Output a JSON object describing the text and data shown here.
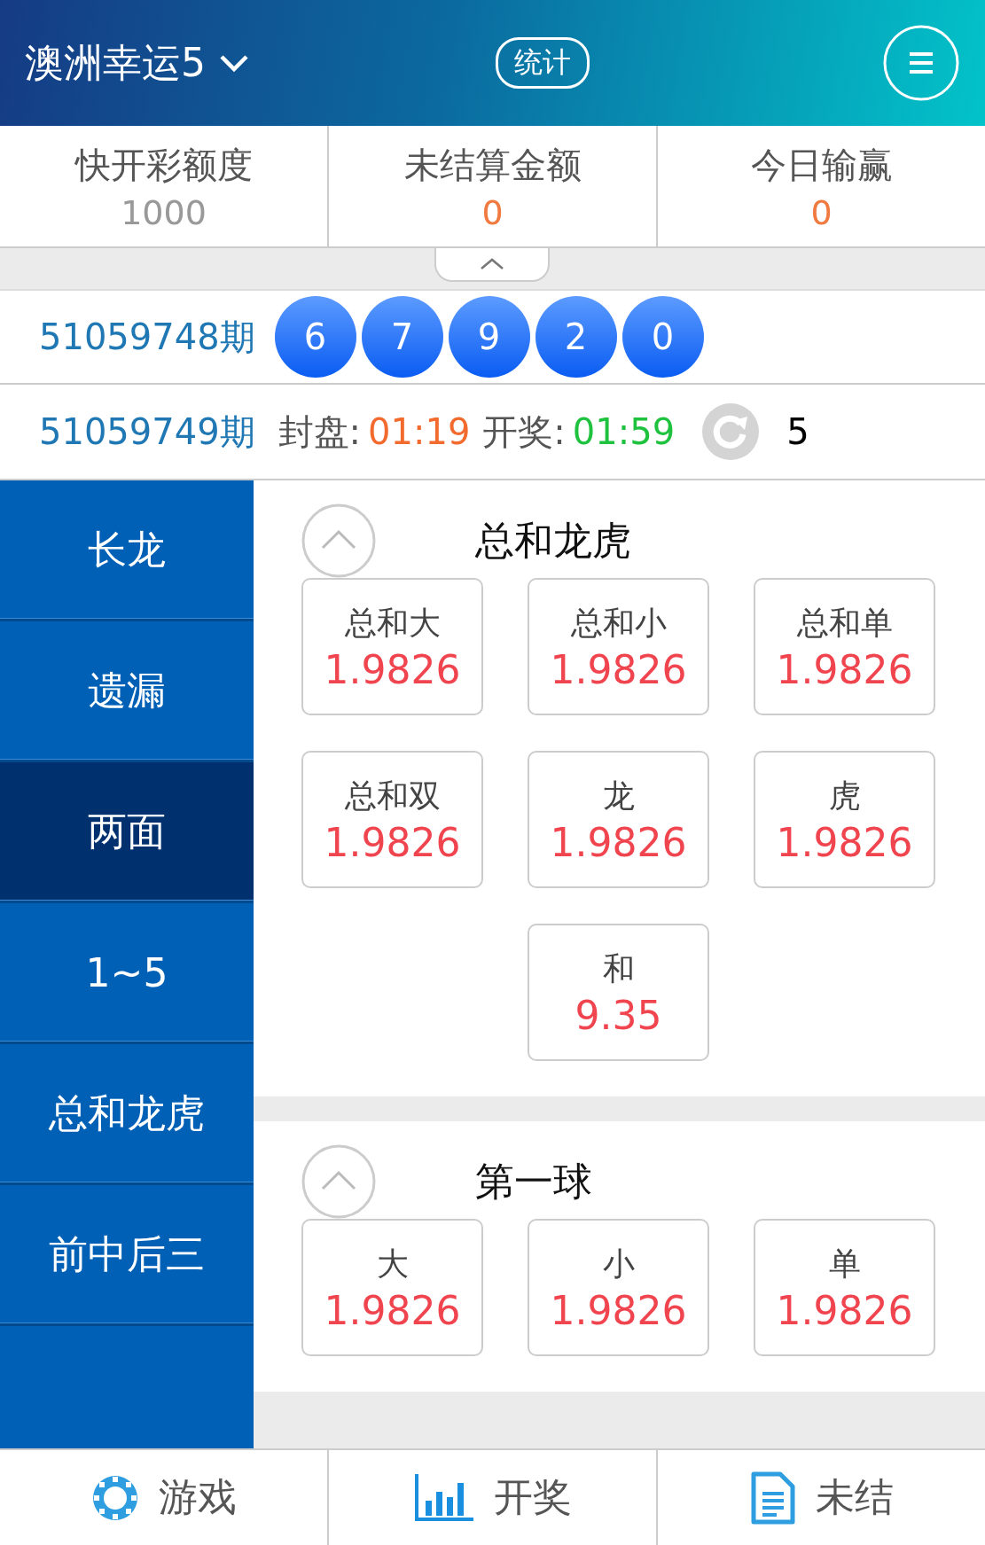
{
  "header": {
    "title": "澳洲幸运5",
    "stats_button": "统计"
  },
  "summary": [
    {
      "label": "快开彩额度",
      "value": "1000",
      "kind": "plain"
    },
    {
      "label": "未结算金额",
      "value": "0",
      "kind": "money"
    },
    {
      "label": "今日输赢",
      "value": "0",
      "kind": "money"
    }
  ],
  "last_draw": {
    "issue": "51059748期",
    "balls": [
      "6",
      "7",
      "9",
      "2",
      "0"
    ]
  },
  "next_draw": {
    "issue": "51059749期",
    "close_label": "封盘:",
    "close_time": "01:19",
    "open_label": "开奖:",
    "open_time": "01:59",
    "refresh_count": "5"
  },
  "sidebar": [
    {
      "label": "长龙",
      "selected": false
    },
    {
      "label": "遗漏",
      "selected": false
    },
    {
      "label": "两面",
      "selected": true
    },
    {
      "label": "1~5",
      "selected": false
    },
    {
      "label": "总和龙虎",
      "selected": false
    },
    {
      "label": "前中后三",
      "selected": false
    }
  ],
  "sections": [
    {
      "title": "总和龙虎",
      "options": [
        {
          "name": "总和大",
          "odds": "1.9826"
        },
        {
          "name": "总和小",
          "odds": "1.9826"
        },
        {
          "name": "总和单",
          "odds": "1.9826"
        },
        {
          "name": "总和双",
          "odds": "1.9826"
        },
        {
          "name": "龙",
          "odds": "1.9826"
        },
        {
          "name": "虎",
          "odds": "1.9826"
        },
        {
          "name": "和",
          "odds": "9.35"
        }
      ]
    },
    {
      "title": "第一球",
      "options": [
        {
          "name": "大",
          "odds": "1.9826"
        },
        {
          "name": "小",
          "odds": "1.9826"
        },
        {
          "name": "单",
          "odds": "1.9826"
        }
      ]
    }
  ],
  "bottom_nav": [
    {
      "label": "游戏",
      "kind": "chip"
    },
    {
      "label": "开奖",
      "kind": "chart"
    },
    {
      "label": "未结",
      "kind": "document"
    }
  ]
}
